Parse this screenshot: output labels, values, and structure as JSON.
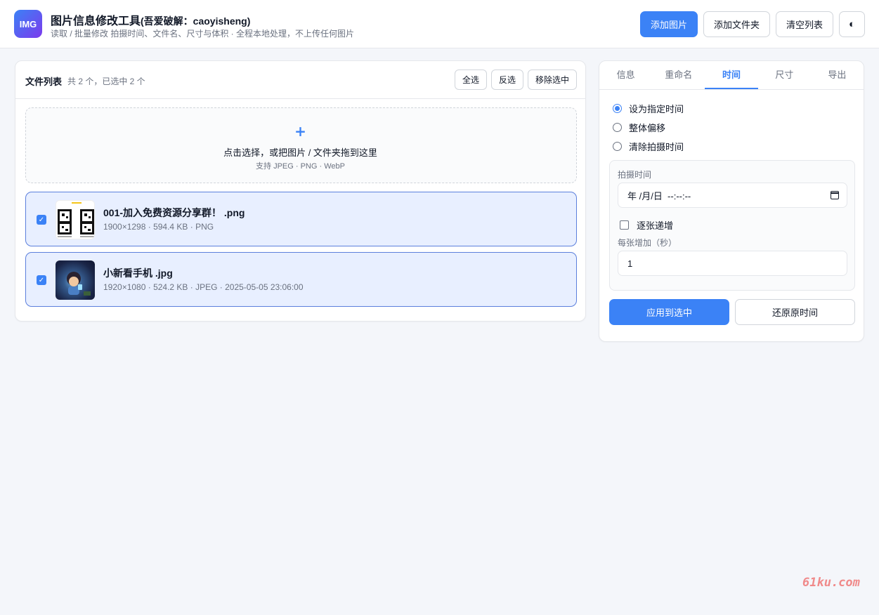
{
  "header": {
    "logo_text": "IMG",
    "title": "图片信息修改工具",
    "title_suffix": "(吾爱破解：caoyisheng)",
    "description": "读取 / 批量修改 拍摄时间、文件名、尺寸与体积 · 全程本地处理，不上传任何图片",
    "buttons": {
      "add_image": "添加图片",
      "add_folder": "添加文件夹",
      "clear_list": "清空列表",
      "theme_toggle": "◐"
    }
  },
  "file_list": {
    "title": "文件列表",
    "count_text": "共 2 个，已选中 2 个",
    "buttons": {
      "select_all": "全选",
      "invert": "反选",
      "remove_selected": "移除选中"
    },
    "dropzone": {
      "plus": "+",
      "main_text": "点击选择，或把图片 / 文件夹拖到这里",
      "sub_text": "支持 JPEG · PNG · WebP"
    },
    "files": [
      {
        "name": "001-加入免费资源分享群！ .png",
        "meta": "1900×1298 · 594.4 KB · PNG",
        "checked": true,
        "thumb": "qr-code-image"
      },
      {
        "name": "小新看手机 .jpg",
        "meta": "1920×1080 · 524.2 KB · JPEG · 2025-05-05 23:06:00",
        "checked": true,
        "thumb": "night-scene-photo"
      }
    ]
  },
  "panel": {
    "tabs": [
      "信息",
      "重命名",
      "时间",
      "尺寸",
      "导出"
    ],
    "active_tab": "时间",
    "radios": [
      {
        "label": "设为指定时间",
        "selected": true
      },
      {
        "label": "整体偏移",
        "selected": false
      },
      {
        "label": "清除拍摄时间",
        "selected": false
      }
    ],
    "datetime_label": "拍摄时间",
    "datetime_value": "年 /月/日  --:--:--",
    "increment_checkbox_label": "逐张递增",
    "increment_checked": false,
    "step_label": "每张增加（秒）",
    "step_value": "1",
    "apply_button": "应用到选中",
    "restore_button": "还原原时间"
  },
  "watermark": "61ku.com",
  "colors": {
    "accent": "#3b82f6",
    "selected_row_bg": "#e8efff",
    "selected_row_border": "#5b7fdc",
    "watermark": "#f08a8a"
  }
}
